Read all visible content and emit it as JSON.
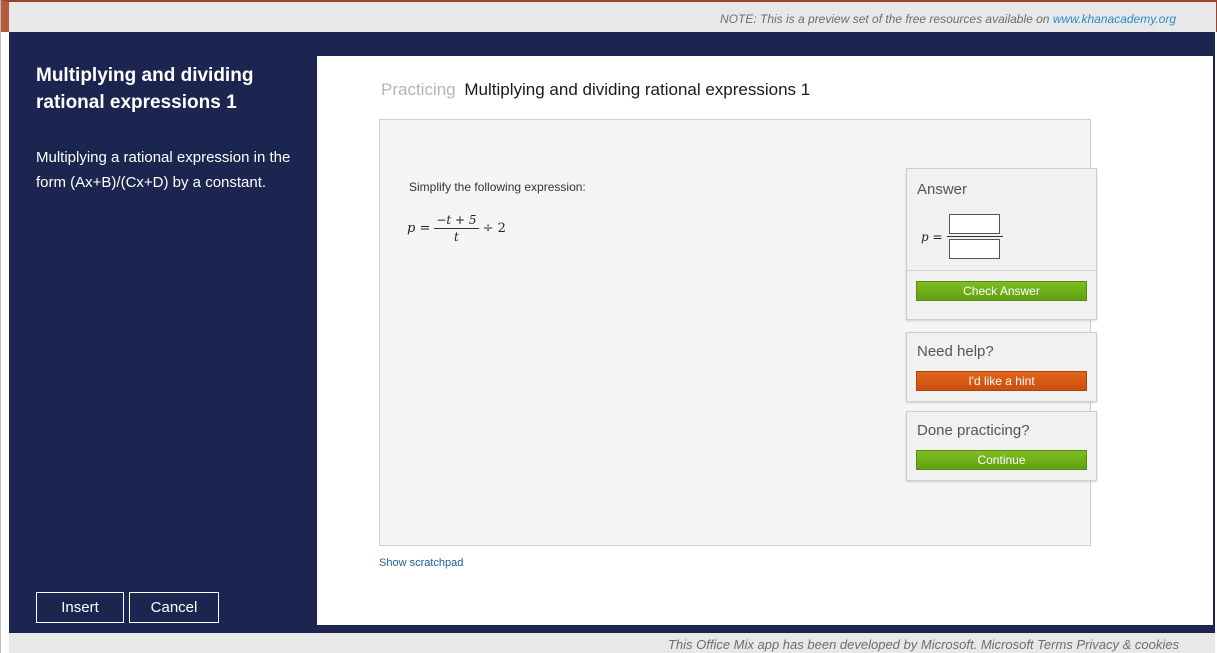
{
  "banner": {
    "note_prefix": "NOTE: This is a preview set of the free resources available on",
    "note_link": "www.khanacademy.org"
  },
  "sidebar": {
    "title": "Multiplying and dividing rational expressions 1",
    "description": "Multiplying a rational expression in the form (Ax+B)/(Cx+D) by a constant.",
    "insert_label": "Insert",
    "cancel_label": "Cancel"
  },
  "main": {
    "heading_prefix": "Practicing",
    "heading_title": "Multiplying and dividing rational expressions 1",
    "problem": {
      "prompt": "Simplify the following expression:",
      "lhs": "p =",
      "numerator": "−t + 5",
      "denominator": "t",
      "operation": "÷ 2"
    },
    "scratchpad_label": "Show scratchpad"
  },
  "answer_card": {
    "title": "Answer",
    "lhs": "p =",
    "numerator_value": "",
    "denominator_value": "",
    "check_label": "Check Answer"
  },
  "help_card": {
    "title": "Need help?",
    "hint_label": "I'd like a hint"
  },
  "done_card": {
    "title": "Done practicing?",
    "continue_label": "Continue"
  },
  "footer": {
    "text": "This Office Mix app has been developed by Microsoft.  Microsoft Terms  Privacy & cookies"
  },
  "colors": {
    "sidebar_bg": "#1c2550",
    "green_button": "#6bad17",
    "orange_button": "#d65a14",
    "link": "#2a8ec4"
  }
}
